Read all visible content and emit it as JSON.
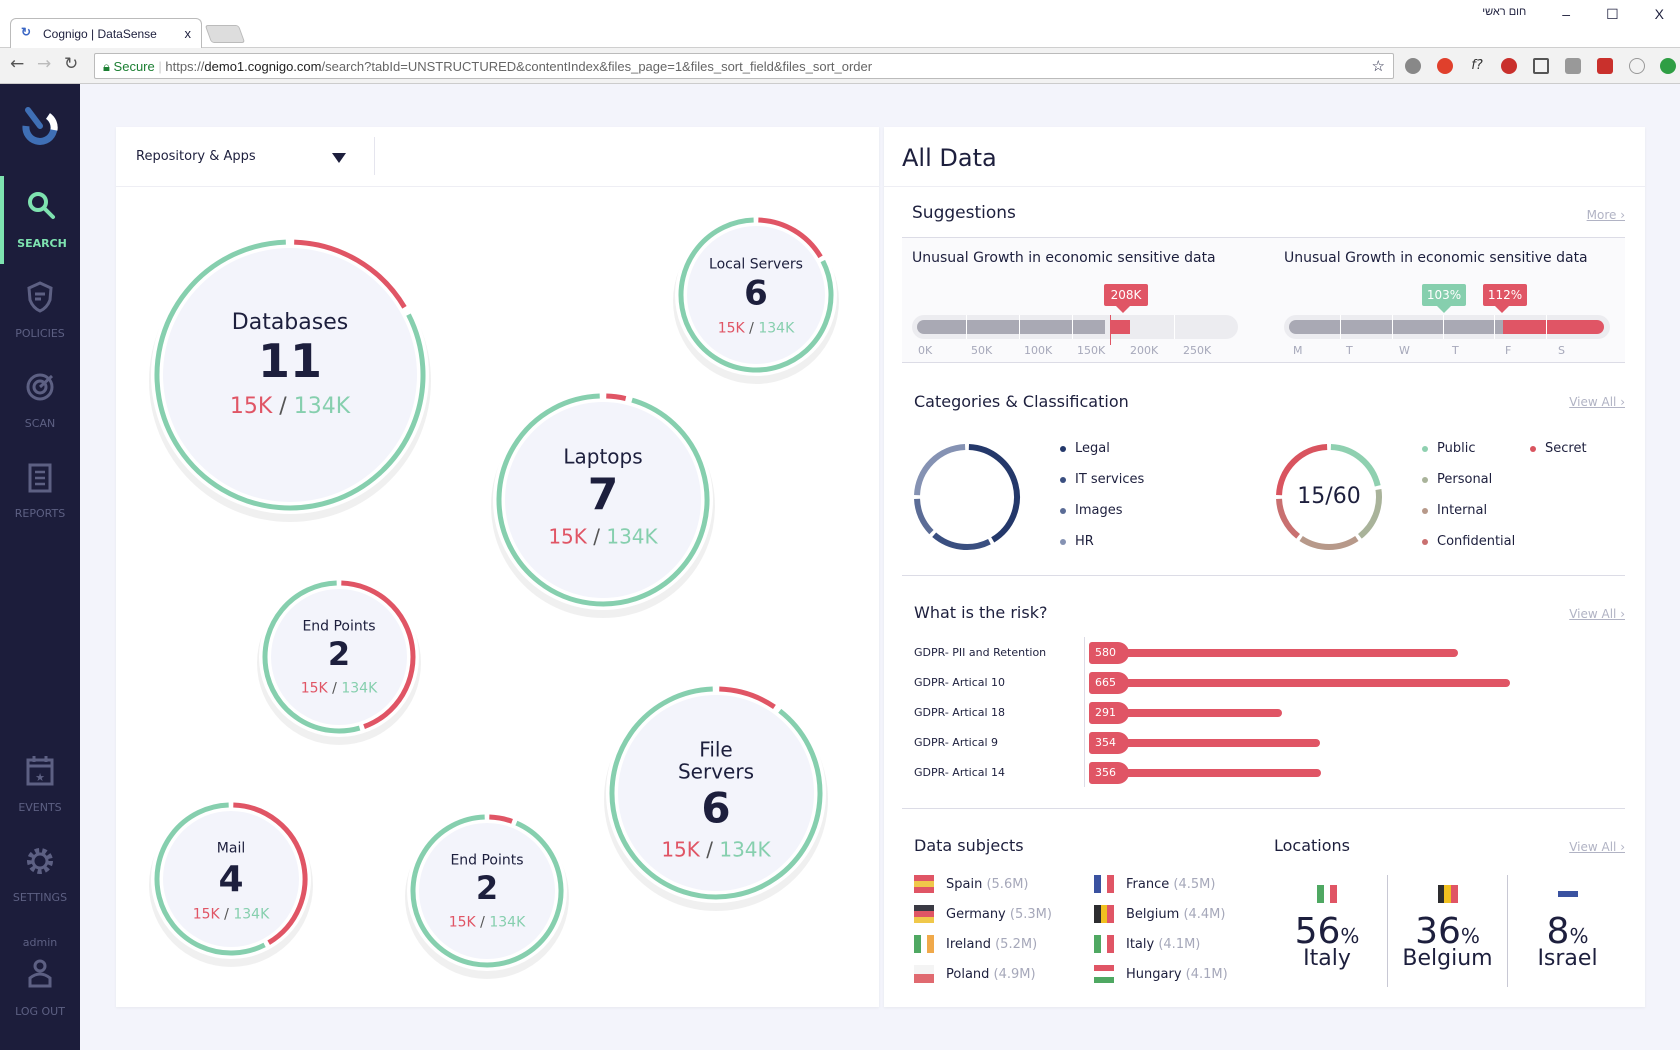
{
  "browser": {
    "tab_title": "Cognigo | DataSense",
    "tab_close": "x",
    "window_label": "חום ראשי",
    "min": "–",
    "max": "☐",
    "close": "X",
    "secure": "Secure",
    "url_scheme": "https://",
    "url_host": "demo1.cognigo.com",
    "url_path": "/search?tabId=UNSTRUCTURED&contentIndex&files_page=1&files_sort_field&files_sort_order"
  },
  "sidebar": {
    "items": [
      {
        "label": "SEARCH",
        "icon": "search-icon",
        "active": true
      },
      {
        "label": "POLICIES",
        "icon": "shield-icon"
      },
      {
        "label": "SCAN",
        "icon": "target-icon"
      },
      {
        "label": "REPORTS",
        "icon": "clipboard-icon"
      },
      {
        "label": "EVENTS",
        "icon": "calendar-star-icon"
      },
      {
        "label": "SETTINGS",
        "icon": "gear-icon"
      }
    ],
    "user": "admin",
    "logout": "LOG OUT"
  },
  "colors": {
    "accent": "#7ee3b0",
    "red": "#e05565",
    "green": "#86cfae",
    "sidebar": "#1c1d3b"
  },
  "left": {
    "dropdown": "Repository & Apps",
    "bubbles": [
      {
        "name": "Databases",
        "count": "11",
        "a": "15K",
        "b": "134K",
        "red_fraction": 0.17
      },
      {
        "name": "Local Servers",
        "count": "6",
        "a": "15K",
        "b": "134K",
        "red_fraction": 0.17
      },
      {
        "name": "Laptops",
        "count": "7",
        "a": "15K",
        "b": "134K",
        "red_fraction": 0.04
      },
      {
        "name": "End Points",
        "count": "2",
        "a": "15K",
        "b": "134K",
        "red_fraction": 0.45
      },
      {
        "name": "File Servers",
        "count": "6",
        "a": "15K",
        "b": "134K",
        "red_fraction": 0.1
      },
      {
        "name": "Mail",
        "count": "4",
        "a": "15K",
        "b": "134K",
        "red_fraction": 0.42
      },
      {
        "name": "End Points",
        "count": "2",
        "a": "15K",
        "b": "134K",
        "red_fraction": 0.06
      }
    ]
  },
  "right": {
    "title": "All Data",
    "suggestions": {
      "title": "Suggestions",
      "more": "More ›",
      "card1": {
        "title": "Unusual Growth in economic sensitive data",
        "marker": "208K",
        "ticks": [
          "0K",
          "50K",
          "100K",
          "150K",
          "200K",
          "250K"
        ],
        "value": 208,
        "threshold": 170
      },
      "card2": {
        "title": "Unusual Growth in economic sensitive data",
        "marker_green": "103%",
        "marker_red": "112%",
        "ticks": [
          "M",
          "T",
          "W",
          "T",
          "F",
          "S"
        ]
      }
    },
    "categories": {
      "title": "Categories & Classification",
      "view_all": "View All ›",
      "legend1": [
        {
          "label": "Legal",
          "color": "#24386a"
        },
        {
          "label": "IT services",
          "color": "#3a4f80"
        },
        {
          "label": "Images",
          "color": "#5b6c96"
        },
        {
          "label": "HR",
          "color": "#8592b3"
        }
      ],
      "center2": "15/60",
      "legend2": [
        {
          "label": "Public",
          "color": "#8fd0b0"
        },
        {
          "label": "Personal",
          "color": "#a9b39a"
        },
        {
          "label": "Internal",
          "color": "#b7998a"
        },
        {
          "label": "Confidential",
          "color": "#c97070"
        },
        {
          "label": "Secret",
          "color": "#d9545f"
        }
      ]
    },
    "risk": {
      "title": "What is the risk?",
      "view_all": "View All ›",
      "rows": [
        {
          "label": "GDPR- PII and Retention",
          "value": 580
        },
        {
          "label": "GDPR- Artical 10",
          "value": 665
        },
        {
          "label": "GDPR- Artical 18",
          "value": 291
        },
        {
          "label": "GDPR- Artical 9",
          "value": 354
        },
        {
          "label": "GDPR- Artical 14",
          "value": 356
        }
      ]
    },
    "subjects": {
      "title": "Data subjects",
      "items": [
        {
          "country": "Spain",
          "count": "(5.6M)"
        },
        {
          "country": "Germany",
          "count": "(5.3M)"
        },
        {
          "country": "Ireland",
          "count": "(5.2M)"
        },
        {
          "country": "Poland",
          "count": "(4.9M)"
        },
        {
          "country": "France",
          "count": "(4.5M)"
        },
        {
          "country": "Belgium",
          "count": "(4.4M)"
        },
        {
          "country": "Italy",
          "count": "(4.1M)"
        },
        {
          "country": "Hungary",
          "count": "(4.1M)"
        }
      ]
    },
    "locations": {
      "title": "Locations",
      "view_all": "View All ›",
      "items": [
        {
          "pct": "56",
          "unit": "%",
          "country": "Italy"
        },
        {
          "pct": "36",
          "unit": "%",
          "country": "Belgium"
        },
        {
          "pct": "8",
          "unit": "%",
          "country": "Israel"
        }
      ]
    }
  }
}
